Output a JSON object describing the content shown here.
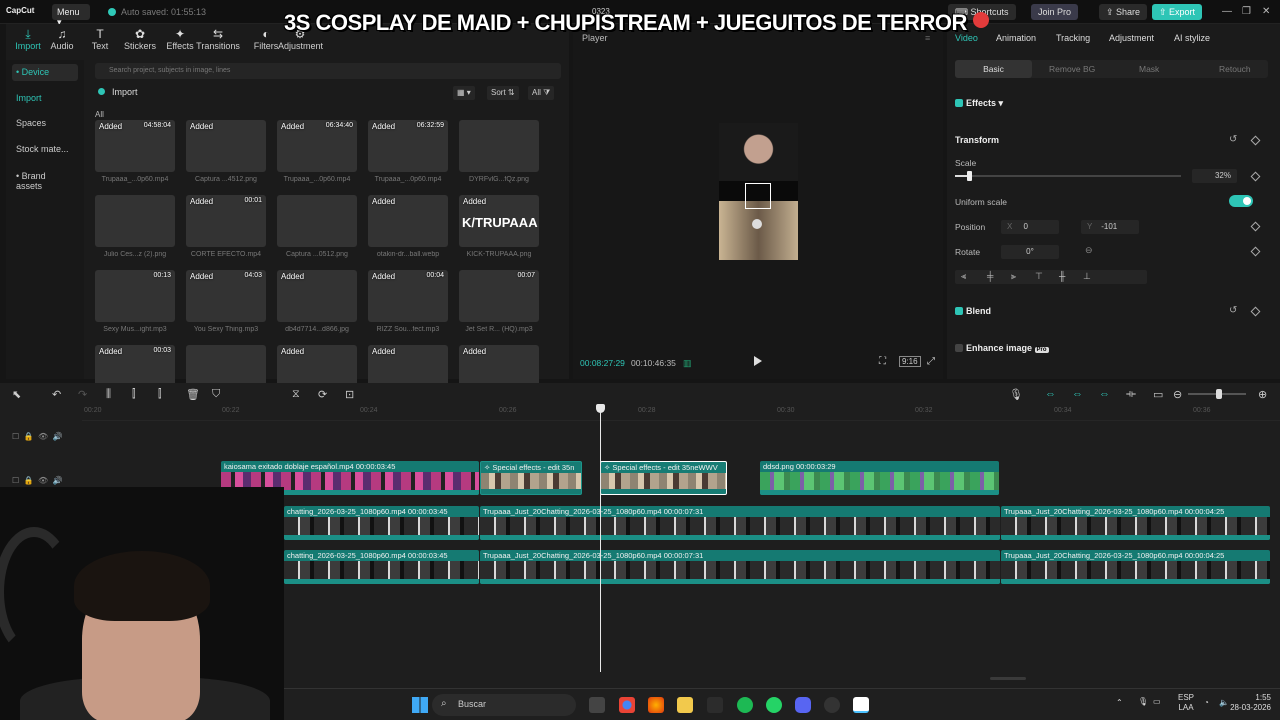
{
  "app": {
    "logo": "CapCut",
    "menu_label": "Menu",
    "autosave": "Auto saved: 01:55:13",
    "project_name": "0323"
  },
  "topbar": {
    "shortcuts": "Shortcuts",
    "join_pro": "Join Pro",
    "share": "Share",
    "export": "Export",
    "accent": "#2ec5b6"
  },
  "overlay_title": "3S COSPLAY DE MAID + CHUPISTREAM + JUEGUITOS DE TERROR",
  "tool_tabs": [
    {
      "label": "Import",
      "icon": "import-icon",
      "active": true
    },
    {
      "label": "Audio",
      "icon": "audio-icon"
    },
    {
      "label": "Text",
      "icon": "text-icon"
    },
    {
      "label": "Stickers",
      "icon": "sticker-icon"
    },
    {
      "label": "Effects",
      "icon": "effects-icon"
    },
    {
      "label": "Transitions",
      "icon": "transitions-icon"
    },
    {
      "label": "Filters",
      "icon": "filters-icon"
    },
    {
      "label": "Adjustment",
      "icon": "adjustment-icon"
    }
  ],
  "sidenav": [
    "• Device",
    "Import",
    "Spaces",
    "Stock mate...",
    "• Brand assets"
  ],
  "search_placeholder": "Search project, subjects in image, lines",
  "import_label": "Import",
  "view_controls": {
    "sort": "Sort",
    "all": "All"
  },
  "all_label": "All",
  "media": [
    {
      "name": "Trupaaa_...0p60.mp4",
      "added": "Added",
      "duration": "04:58:04",
      "style": "th-dark"
    },
    {
      "name": "Captura ...4512.png",
      "added": "Added",
      "duration": "",
      "style": "th-light"
    },
    {
      "name": "Trupaaa_...0p60.mp4",
      "added": "Added",
      "duration": "06:34:40",
      "style": "th-dark"
    },
    {
      "name": "Trupaaa_...0p60.mp4",
      "added": "Added",
      "duration": "06:32:59",
      "style": "th-dark"
    },
    {
      "name": "DYRFvlG...fQz.png",
      "added": "",
      "duration": "",
      "style": "th-char"
    },
    {
      "name": "Julio Ces...z (2).png",
      "added": "",
      "duration": "",
      "style": "th-face"
    },
    {
      "name": "CORTE EFECTO.mp4",
      "added": "Added",
      "duration": "00:01",
      "style": "th-bars"
    },
    {
      "name": "Captura ...0512.png",
      "added": "",
      "duration": "",
      "style": "th-bw"
    },
    {
      "name": "otakin-dr...ball.webp",
      "added": "Added",
      "duration": "",
      "style": "th-crowd"
    },
    {
      "name": "KICK-TRUPAAA.png",
      "added": "Added",
      "duration": "",
      "style": "th-kick",
      "overlay": "K/TRUPAAA"
    },
    {
      "name": "Sexy Mus...ight.mp3",
      "added": "",
      "duration": "00:13",
      "style": "th-audio"
    },
    {
      "name": "You Sexy Thing.mp3",
      "added": "Added",
      "duration": "04:03",
      "style": "th-audio2"
    },
    {
      "name": "db4d7714...d866.jpg",
      "added": "Added",
      "duration": "",
      "style": "th-cat"
    },
    {
      "name": "RIZZ Sou...fect.mp3",
      "added": "Added",
      "duration": "00:04",
      "style": "th-audio2"
    },
    {
      "name": "Jet Set R... (HQ).mp3",
      "added": "",
      "duration": "00:07",
      "style": "th-audio"
    },
    {
      "name": "",
      "added": "Added",
      "duration": "00:03",
      "style": "th-audio2"
    },
    {
      "name": "",
      "added": "",
      "duration": "",
      "style": "th-person"
    },
    {
      "name": "",
      "added": "Added",
      "duration": "",
      "style": "th-emoji"
    },
    {
      "name": "",
      "added": "Added",
      "duration": "",
      "style": "th-person"
    },
    {
      "name": "",
      "added": "Added",
      "duration": "",
      "style": "th-web"
    }
  ],
  "player": {
    "label": "Player",
    "current": "00:08:27:29",
    "total": "00:10:46:35",
    "ratio": "9:16"
  },
  "right": {
    "tabs": [
      "Video",
      "Animation",
      "Tracking",
      "Adjustment",
      "AI stylize"
    ],
    "subtabs": [
      "Basic",
      "Remove BG",
      "Mask",
      "Retouch"
    ],
    "effects": "Effects",
    "transform": "Transform",
    "scale_label": "Scale",
    "scale_value": "32%",
    "scale_fraction": 0.06,
    "uniform_scale": "Uniform scale",
    "position_label": "Position",
    "pos_x_label": "X",
    "pos_x": "0",
    "pos_y_label": "Y",
    "pos_y": "-101",
    "rotate_label": "Rotate",
    "rotate_value": "0°",
    "blend": "Blend",
    "enhance": "Enhance image",
    "pro_badge": "Pro"
  },
  "timeline": {
    "ruler": [
      "00:20",
      "00:22",
      "00:24",
      "00:26",
      "00:28",
      "00:30",
      "00:32",
      "00:34",
      "00:36"
    ],
    "clips": [
      {
        "title": "kaiosama exitado doblaje español.mp4  00:00:03:45",
        "kind": "kai"
      },
      {
        "title": "Special effects - edit  35n",
        "kind": "fx"
      },
      {
        "title": "Special effects - edit  35neWWV",
        "kind": "fx sel"
      },
      {
        "title": "ddsd.png  00:00:03:29",
        "kind": "img"
      }
    ],
    "main_clips": [
      {
        "title": "chatting_2026-03-25_1080p60.mp4  00:00:03:45"
      },
      {
        "title": "Trupaaa_Just_20Chatting_2026-03-25_1080p60.mp4  00:00:07:31"
      },
      {
        "title": "Trupaaa_Just_20Chatting_2026-03-25_1080p60.mp4  00:00:04:25"
      }
    ]
  },
  "taskbar": {
    "search": "Buscar",
    "lang": "ESP",
    "lang2": "LAA",
    "time": "1:55",
    "date": "28-03-2026"
  }
}
